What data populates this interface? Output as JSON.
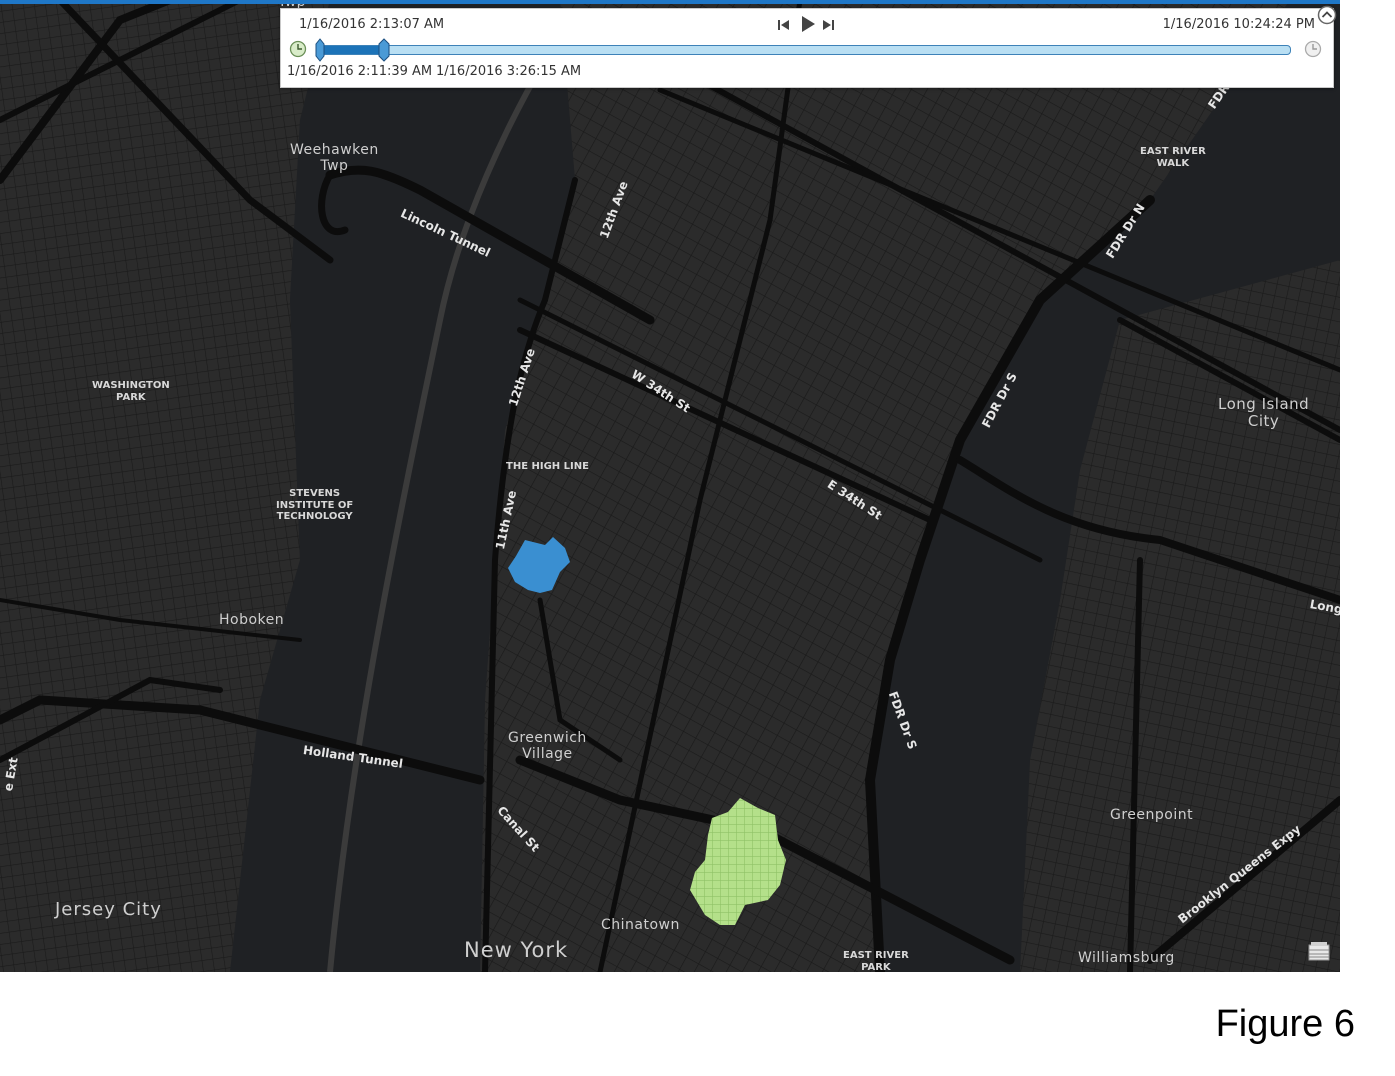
{
  "time_slider": {
    "current_time": "1/16/2016 2:13:07 AM",
    "end_time": "1/16/2016 10:24:24 PM",
    "start_label": "1/16/2016 2:11:39 AM",
    "window_end_label": "1/16/2016 3:26:15 AM",
    "selection_start_fraction": 0.0,
    "selection_end_fraction": 0.066
  },
  "map": {
    "place_labels": {
      "weehawken": "Weehawken\nTwp",
      "twp_top": "Twp",
      "washington_park": "WASHINGTON\nPARK",
      "stevens": "STEVENS\nINSTITUTE OF\nTECHNOLOGY",
      "hoboken": "Hoboken",
      "jersey_city": "Jersey City",
      "new_york": "New York",
      "greenwich_village": "Greenwich\nVillage",
      "chinatown": "Chinatown",
      "the_high_line": "THE HIGH LINE",
      "east_river_walk": "EAST RIVER\nWALK",
      "east_river_park": "EAST RIVER\nPARK",
      "long_island_city": "Long Island\nCity",
      "greenpoint": "Greenpoint",
      "williamsburg": "Williamsburg"
    },
    "road_labels": {
      "lincoln_tunnel": "Lincoln Tunnel",
      "holland_tunnel": "Holland Tunnel",
      "twelfth_ave_upper": "12th Ave",
      "twelfth_ave_lower": "12th Ave",
      "eleventh_ave": "11th Ave",
      "w_34th": "W 34th St",
      "e_34th": "E 34th St",
      "fdr_n": "FDR Dr N",
      "fdr_s_upper": "FDR Dr S",
      "fdr_s_lower": "FDR Dr S",
      "fdr_top": "FDR",
      "canal_st": "Canal St",
      "bqe": "Brooklyn Queens Expy",
      "long_right": "Long",
      "ext_left": "e Ext"
    },
    "clusters": [
      {
        "name": "blue-cluster",
        "color": "#3a8fd1"
      },
      {
        "name": "green-cluster",
        "color": "#b4e08a"
      }
    ],
    "basemap_colors": {
      "land": "#2a2a2a",
      "water": "#1e2022",
      "road": "#0d0d0d"
    }
  },
  "caption": "Figure 6"
}
